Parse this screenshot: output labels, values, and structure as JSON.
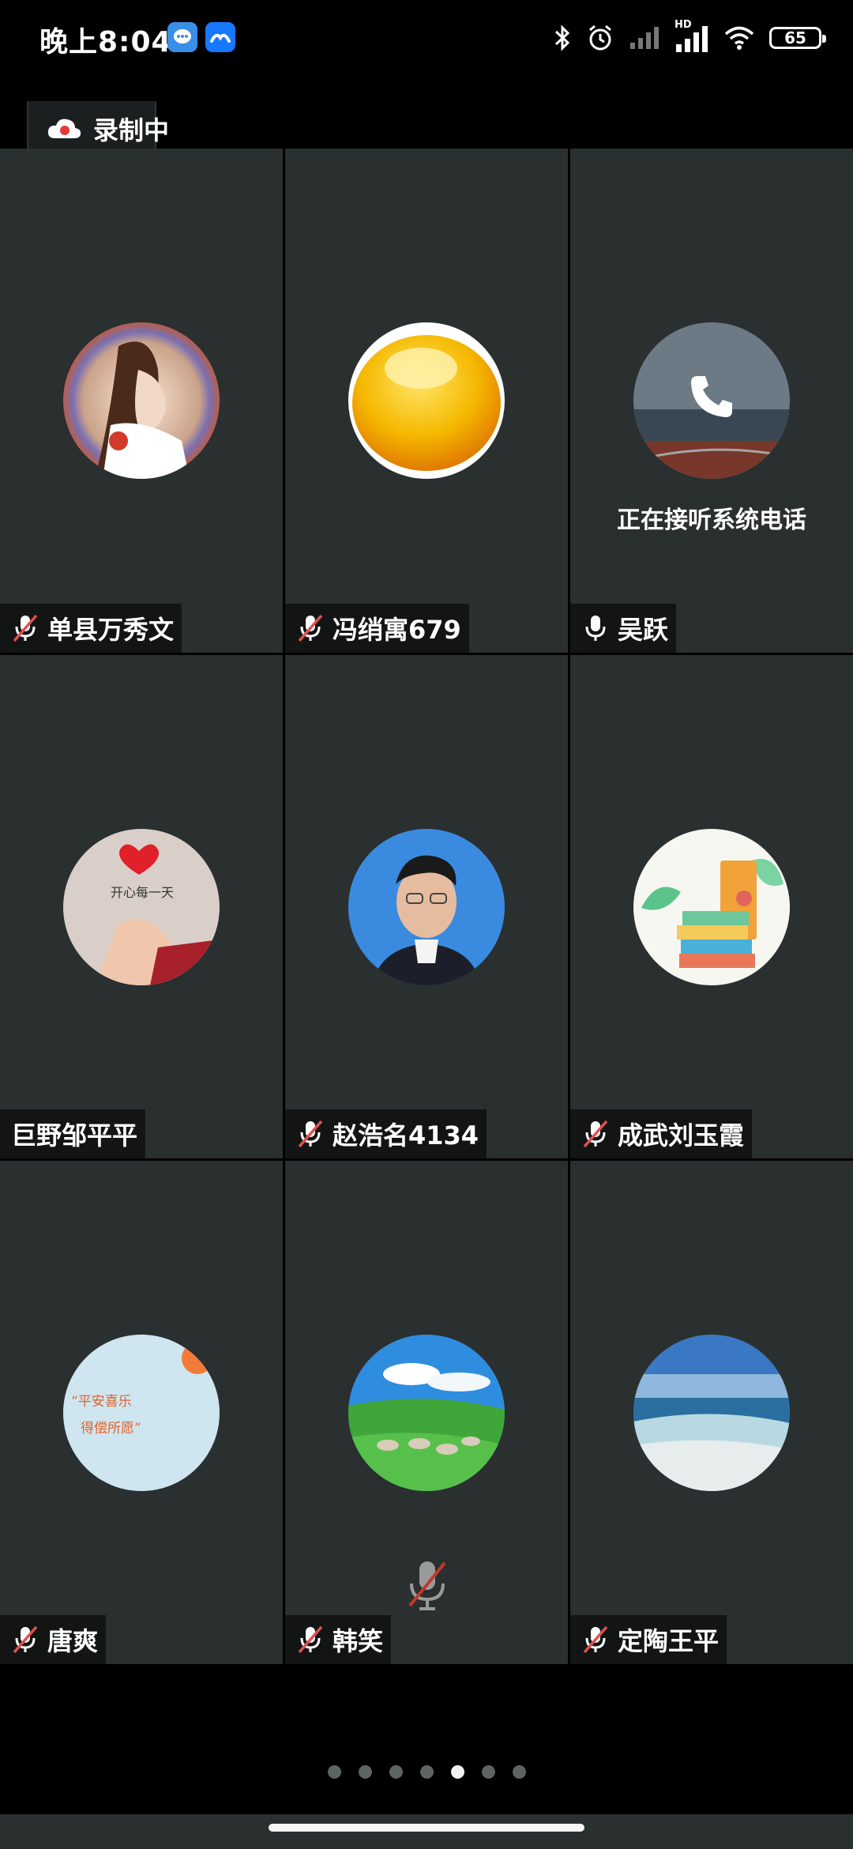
{
  "status_bar": {
    "time": "晚上8:04",
    "battery": "65",
    "network_label": "HD",
    "icons": [
      "bubble-app-icon",
      "feishu-app-icon",
      "bluetooth-icon",
      "alarm-icon",
      "signal-empty-icon",
      "signal-hd-icon",
      "wifi-icon",
      "battery-icon"
    ]
  },
  "recording": {
    "label": "录制中"
  },
  "participants": [
    {
      "name": "单县万秀文",
      "muted": true
    },
    {
      "name": "冯绡寓679",
      "muted": true
    },
    {
      "name": "吴跃",
      "muted": false,
      "status": "正在接听系统电话"
    },
    {
      "name": "巨野邹平平",
      "muted": null
    },
    {
      "name": "赵浩名4134",
      "muted": true
    },
    {
      "name": "成武刘玉霞",
      "muted": true
    },
    {
      "name": "唐爽",
      "muted": true
    },
    {
      "name": "韩笑",
      "muted": true
    },
    {
      "name": "定陶王平",
      "muted": true
    }
  ],
  "avatar_texts": {
    "tang_line1": "“平安喜乐",
    "tang_line2": "得偿所愿”",
    "heart_caption": "开心每一天"
  },
  "pagination": {
    "total": 7,
    "active": 4
  },
  "colors": {
    "tile_bg": "#2a2f30",
    "grid_line": "#000000",
    "mute_slash": "#e05050",
    "active_dot": "#f2f2f2"
  }
}
